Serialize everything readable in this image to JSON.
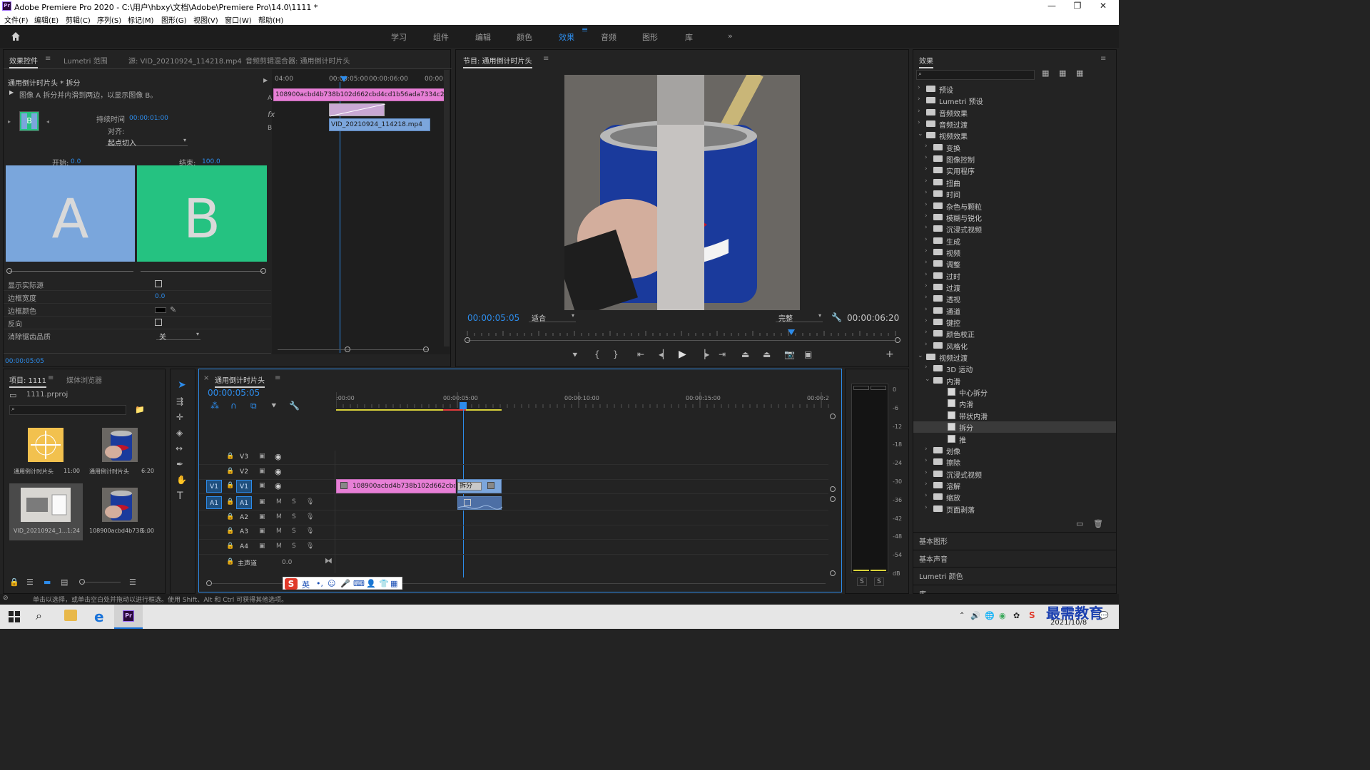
{
  "window": {
    "title": "Adobe Premiere Pro 2020 - C:\\用户\\hbxy\\文档\\Adobe\\Premiere Pro\\14.0\\1111 *",
    "app_badge": "Pr",
    "controls": [
      "—",
      "❐",
      "✕"
    ]
  },
  "menu": [
    "文件(F)",
    "编辑(E)",
    "剪辑(C)",
    "序列(S)",
    "标记(M)",
    "图形(G)",
    "视图(V)",
    "窗口(W)",
    "帮助(H)"
  ],
  "workspaces": [
    "学习",
    "组件",
    "编辑",
    "颜色",
    "效果",
    "音频",
    "图形",
    "库"
  ],
  "workspace_active": "效果",
  "workspace_more": "»",
  "effect_controls": {
    "tabs": [
      "效果控件",
      "Lumetri 范围",
      "源: VID_20210924_114218.mp4",
      "音频剪辑混合器: 通用倒计时片头"
    ],
    "tab_menu_icon": "≡",
    "header": "通用倒计时片头 * 拆分",
    "description": "图像 A 拆分并内滑到两边，以显示图像 B。",
    "thumb_label": "B",
    "duration_label": "持续时间",
    "duration_value": "00:00:01:00",
    "align_label": "对齐:",
    "align_value": "起点切入",
    "start_label": "开始:",
    "start_value": "0.0",
    "end_label": "结束:",
    "end_value": "100.0",
    "preview_a": "A",
    "preview_b": "B",
    "color_a": "#7aa6dc",
    "color_b": "#25c281",
    "props": [
      {
        "label": "显示实际源",
        "kind": "checkbox"
      },
      {
        "label": "边框宽度",
        "kind": "value",
        "value": "0.0"
      },
      {
        "label": "边框颜色",
        "kind": "color"
      },
      {
        "label": "反向",
        "kind": "checkbox"
      },
      {
        "label": "消除锯齿品质",
        "kind": "select",
        "value": "关"
      }
    ],
    "timecode": "00:00:05:05",
    "mini_timeline": {
      "ruler": [
        "04:00",
        "00:00:05:00",
        "00:00:06:00",
        "00:00:"
      ],
      "clip_a": "108900acbd4b738b102d662cbd4cd1b56ada7334c21fef4b6d",
      "clip_b": "VID_20210924_114218.mp4",
      "track_a": "A",
      "track_b": "B",
      "fx": "fx"
    }
  },
  "program": {
    "title": "节目: 通用倒计时片头",
    "tab_menu_icon": "≡",
    "timecode": "00:00:05:05",
    "fit": "适合",
    "quality": "完整",
    "duration": "00:00:06:20",
    "scrub_fraction": 0.757
  },
  "effects": {
    "title": "效果",
    "tab_menu_icon": "≡",
    "items": [
      {
        "t": "预设",
        "lv": 0,
        "kind": "folder",
        "open": false
      },
      {
        "t": "Lumetri 预设",
        "lv": 0,
        "kind": "folder",
        "open": false
      },
      {
        "t": "音频效果",
        "lv": 0,
        "kind": "folder",
        "open": false
      },
      {
        "t": "音频过渡",
        "lv": 0,
        "kind": "folder",
        "open": false
      },
      {
        "t": "视频效果",
        "lv": 0,
        "kind": "folder",
        "open": true
      },
      {
        "t": "变换",
        "lv": 1,
        "kind": "folder",
        "open": false
      },
      {
        "t": "图像控制",
        "lv": 1,
        "kind": "folder",
        "open": false
      },
      {
        "t": "实用程序",
        "lv": 1,
        "kind": "folder",
        "open": false
      },
      {
        "t": "扭曲",
        "lv": 1,
        "kind": "folder",
        "open": false
      },
      {
        "t": "时间",
        "lv": 1,
        "kind": "folder",
        "open": false
      },
      {
        "t": "杂色与颗粒",
        "lv": 1,
        "kind": "folder",
        "open": false
      },
      {
        "t": "模糊与锐化",
        "lv": 1,
        "kind": "folder",
        "open": false
      },
      {
        "t": "沉浸式视频",
        "lv": 1,
        "kind": "folder",
        "open": false
      },
      {
        "t": "生成",
        "lv": 1,
        "kind": "folder",
        "open": false
      },
      {
        "t": "视频",
        "lv": 1,
        "kind": "folder",
        "open": false
      },
      {
        "t": "调整",
        "lv": 1,
        "kind": "folder",
        "open": false
      },
      {
        "t": "过时",
        "lv": 1,
        "kind": "folder",
        "open": false
      },
      {
        "t": "过渡",
        "lv": 1,
        "kind": "folder",
        "open": false
      },
      {
        "t": "透视",
        "lv": 1,
        "kind": "folder",
        "open": false
      },
      {
        "t": "通道",
        "lv": 1,
        "kind": "folder",
        "open": false
      },
      {
        "t": "键控",
        "lv": 1,
        "kind": "folder",
        "open": false
      },
      {
        "t": "颜色校正",
        "lv": 1,
        "kind": "folder",
        "open": false
      },
      {
        "t": "风格化",
        "lv": 1,
        "kind": "folder",
        "open": false
      },
      {
        "t": "视频过渡",
        "lv": 0,
        "kind": "folder",
        "open": true
      },
      {
        "t": "3D 运动",
        "lv": 1,
        "kind": "folder",
        "open": false
      },
      {
        "t": "内滑",
        "lv": 1,
        "kind": "folder",
        "open": true
      },
      {
        "t": "中心拆分",
        "lv": 2,
        "kind": "fx"
      },
      {
        "t": "内滑",
        "lv": 2,
        "kind": "fx"
      },
      {
        "t": "带状内滑",
        "lv": 2,
        "kind": "fx"
      },
      {
        "t": "拆分",
        "lv": 2,
        "kind": "fx",
        "selected": true
      },
      {
        "t": "推",
        "lv": 2,
        "kind": "fx"
      },
      {
        "t": "划像",
        "lv": 1,
        "kind": "folder",
        "open": false
      },
      {
        "t": "擦除",
        "lv": 1,
        "kind": "folder",
        "open": false
      },
      {
        "t": "沉浸式视频",
        "lv": 1,
        "kind": "folder",
        "open": false
      },
      {
        "t": "溶解",
        "lv": 1,
        "kind": "folder",
        "open": false
      },
      {
        "t": "缩放",
        "lv": 1,
        "kind": "folder",
        "open": false
      },
      {
        "t": "页面剥落",
        "lv": 1,
        "kind": "folder",
        "open": false
      }
    ],
    "bottom_panels": [
      "基本图形",
      "基本声音",
      "Lumetri 颜色",
      "库"
    ]
  },
  "project": {
    "tabs": [
      "项目: 1111",
      "媒体浏览器"
    ],
    "tab_menu_icon": "≡",
    "file": "1111.prproj",
    "bins": [
      {
        "name": "通用倒计时片头",
        "dur": "11:00",
        "kind": "countdown"
      },
      {
        "name": "通用倒计时片头",
        "dur": "6:20",
        "kind": "can"
      },
      {
        "name": "VID_20210924_1...",
        "dur": "1:24",
        "kind": "room"
      },
      {
        "name": "108900acbd4b738...",
        "dur": "5:00",
        "kind": "can"
      }
    ]
  },
  "timeline": {
    "title": "通用倒计时片头",
    "close": "×",
    "tab_menu_icon": "≡",
    "timecode": "00:00:05:05",
    "ruler": [
      ":00:00",
      "00:00:05:00",
      "00:00:10:00",
      "00:00:15:00",
      "00:00:2"
    ],
    "video_tracks": [
      "V3",
      "V2",
      "V1"
    ],
    "audio_tracks": [
      "A1",
      "A2",
      "A3",
      "A4"
    ],
    "source_v": "V1",
    "source_a": "A1",
    "master": "主声道",
    "master_value": "0.0",
    "mute": "M",
    "solo": "S",
    "clip_v1": "108900acbd4b738b102d662cbd4cd1b56ad",
    "transition": "拆分",
    "playhead_fraction": 0.256
  },
  "meter": {
    "labels": [
      "0",
      "-6",
      "-12",
      "-18",
      "-24",
      "-30",
      "-36",
      "-42",
      "-48",
      "-54",
      "dB"
    ],
    "solo": [
      "S",
      "S"
    ]
  },
  "status": "单击以选择，或单击空白处并拖动以进行框选。使用 Shift、Alt 和 Ctrl 可获得其他选项。",
  "ime": [
    "英"
  ],
  "taskbar": {
    "date": "2021/10/8",
    "watermark": "最需教育"
  }
}
